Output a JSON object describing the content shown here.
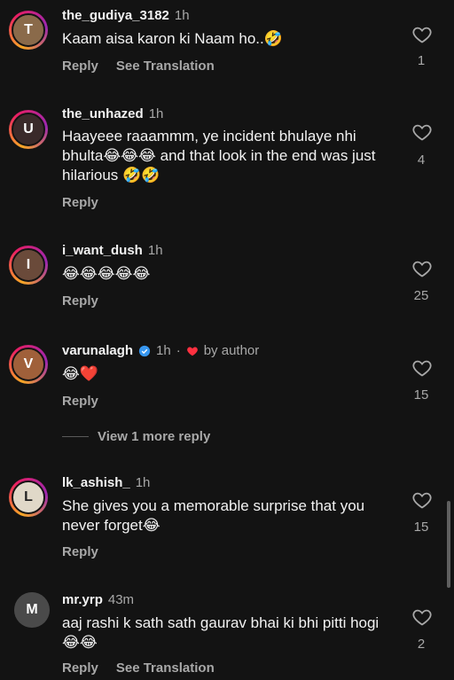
{
  "comments": [
    {
      "username": "the_gudiya_3182",
      "time": "1h",
      "text": "Kaam aisa karon ki Naam ho..🤣",
      "reply": "Reply",
      "translate": "See Translation",
      "likes": "1",
      "avatar_initial": "T",
      "avatar_color": "#8a6a4a"
    },
    {
      "username": "the_unhazed",
      "time": "1h",
      "text": "Haayeee raaammm, ye incident bhulaye nhi bhulta😂😂😂 and that look in the end was just hilarious 🤣🤣",
      "reply": "Reply",
      "likes": "4",
      "avatar_initial": "U",
      "avatar_color": "#3a2a2a"
    },
    {
      "username": "i_want_dush",
      "time": "1h",
      "text": "😂😂😂😂😂",
      "reply": "Reply",
      "likes": "25",
      "avatar_initial": "I",
      "avatar_color": "#6a4a3a"
    },
    {
      "username": "varunalagh",
      "time": "1h",
      "by_author": "by author",
      "text": "😂❤️",
      "reply": "Reply",
      "likes": "15",
      "avatar_initial": "V",
      "avatar_color": "#a0603a"
    },
    {
      "username": "lk_ashish_",
      "time": "1h",
      "text": "She gives you a memorable surprise that you never forget😂",
      "reply": "Reply",
      "likes": "15",
      "avatar_initial": "L",
      "avatar_color": "#e0d8c8"
    },
    {
      "username": "mr.yrp",
      "time": "43m",
      "text": "aaj rashi k sath sath gaurav bhai ki bhi pitti hogi 😂😂",
      "reply": "Reply",
      "translate": "See Translation",
      "likes": "2",
      "avatar_initial": "M",
      "avatar_color": "#4a4a4a"
    }
  ],
  "view_more_reply": "View 1 more reply",
  "colors": {
    "background": "#131313",
    "secondary_text": "#a8a8a8",
    "verified": "#3797f0",
    "heart_red": "#ff3040"
  },
  "icons": {
    "like": "heart-outline-icon",
    "verified": "verified-badge-icon",
    "author_like": "red-heart-icon"
  }
}
